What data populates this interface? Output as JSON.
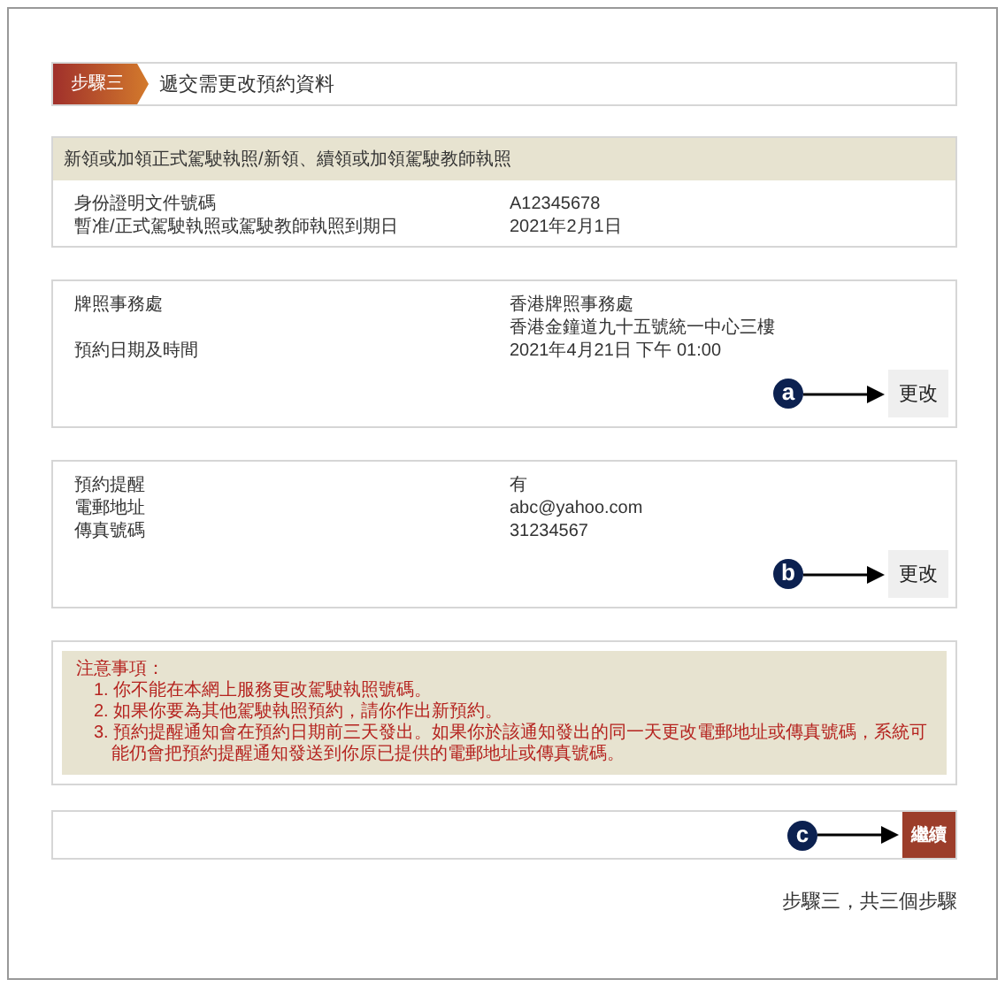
{
  "step": {
    "badge": "步驟三",
    "title": "遞交需更改預約資料"
  },
  "licence_section": {
    "title": "新領或加領正式駕駛執照/新領、續領或加領駕駛教師執照",
    "rows": [
      {
        "label": "身份證明文件號碼",
        "value": [
          "A12345678"
        ]
      },
      {
        "label": "暫准/正式駕駛執照或駕駛教師執照到期日",
        "value": [
          "2021年2月1日"
        ]
      }
    ]
  },
  "appointment_section": {
    "rows": [
      {
        "label": "牌照事務處",
        "value": [
          "香港牌照事務處",
          "香港金鐘道九十五號統一中心三樓"
        ]
      },
      {
        "label": "預約日期及時間",
        "value": [
          "2021年4月21日 下午 01:00"
        ]
      }
    ],
    "marker": "a",
    "button": "更改"
  },
  "reminder_section": {
    "rows": [
      {
        "label": "預約提醒",
        "value": [
          "有"
        ]
      },
      {
        "label": "電郵地址",
        "value": [
          "abc@yahoo.com"
        ]
      },
      {
        "label": "傳真號碼",
        "value": [
          "31234567"
        ]
      }
    ],
    "marker": "b",
    "button": "更改"
  },
  "notes": {
    "title": "注意事項：",
    "items": [
      "1. 你不能在本網上服務更改駕駛執照號碼。",
      "2. 如果你要為其他駕駛執照預約，請你作出新預約。",
      "3. 預約提醒通知會在預約日期前三天發出。如果你於該通知發出的同一天更改電郵地址或傳真號碼，系統可能仍會把預約提醒通知發送到你原已提供的電郵地址或傳真號碼。"
    ]
  },
  "continue": {
    "marker": "c",
    "button": "繼續"
  },
  "footer": "步驟三，共三個步驟"
}
